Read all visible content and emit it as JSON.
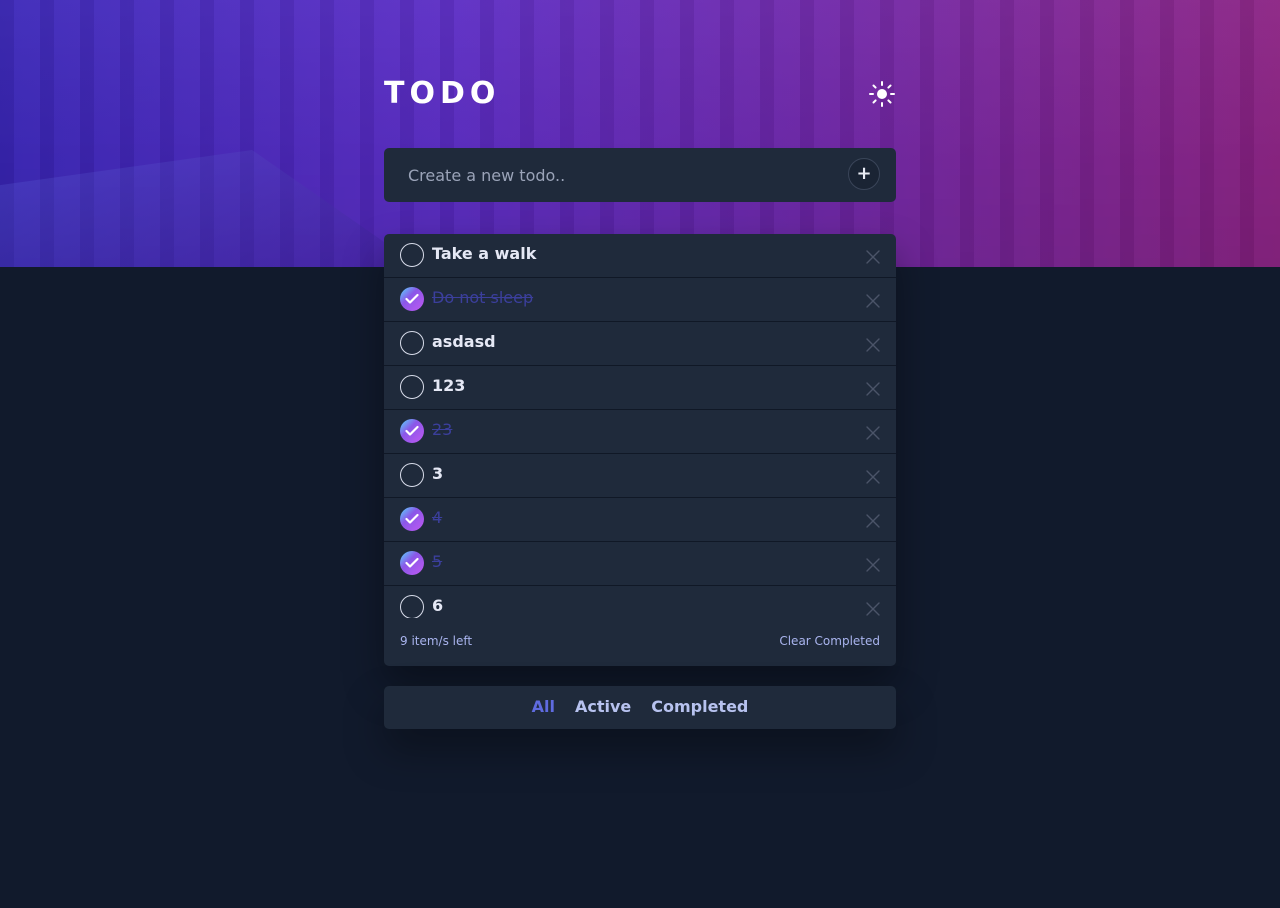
{
  "header": {
    "title": "TODO",
    "theme_icon": "sun-icon"
  },
  "new_todo": {
    "placeholder": "Create a new todo..",
    "value": "",
    "add_label": "+"
  },
  "todos": [
    {
      "text": "Take a walk",
      "completed": false
    },
    {
      "text": "Do not sleep",
      "completed": true
    },
    {
      "text": "asdasd",
      "completed": false
    },
    {
      "text": "123",
      "completed": false
    },
    {
      "text": "23",
      "completed": true
    },
    {
      "text": "3",
      "completed": false
    },
    {
      "text": "4",
      "completed": true
    },
    {
      "text": "5",
      "completed": true
    },
    {
      "text": "6",
      "completed": false
    }
  ],
  "footer": {
    "items_left": "9 item/s left",
    "clear_completed": "Clear Completed"
  },
  "filters": {
    "items": [
      "All",
      "Active",
      "Completed"
    ],
    "active": "All"
  },
  "colors": {
    "background": "#111a2c",
    "card": "#1f2a3b",
    "accent": "#5f6be0",
    "check_gradient_start": "#57ddff",
    "check_gradient_end": "#c058f3"
  }
}
